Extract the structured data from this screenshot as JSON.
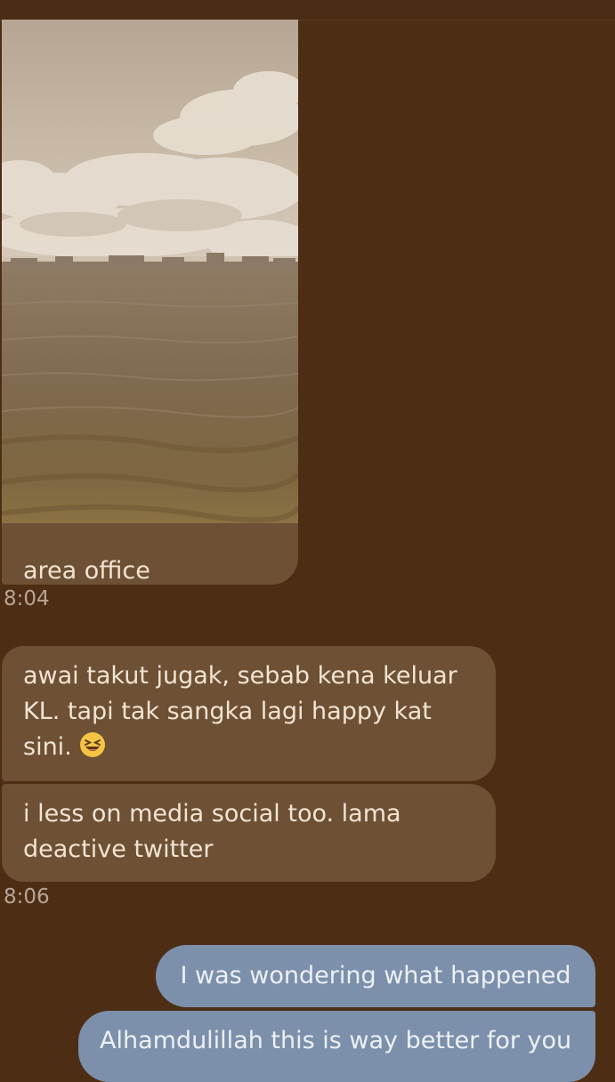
{
  "header": {
    "partial_text": ""
  },
  "messages": {
    "photo": {
      "icon": "beach-photo",
      "caption": "area office",
      "time": "8:04"
    },
    "incoming": [
      {
        "lines": [
          "awai takut jugak, sebab kena keluar",
          "KL. tapi tak sangka lagi happy kat",
          "sini."
        ],
        "emoji": "laughing-face-emoji"
      },
      {
        "lines": [
          "i less on media social too. lama",
          "deactive twitter"
        ]
      }
    ],
    "incoming_time": "8:06",
    "outgoing": [
      {
        "text": "I was wondering what happened"
      },
      {
        "text": "Alhamdulillah this is way better for you"
      }
    ]
  },
  "colors": {
    "background": "#4d2e15",
    "incoming_bubble": "#6e5034",
    "outgoing_bubble": "#7c90ab",
    "timestamp": "#b8a596"
  }
}
